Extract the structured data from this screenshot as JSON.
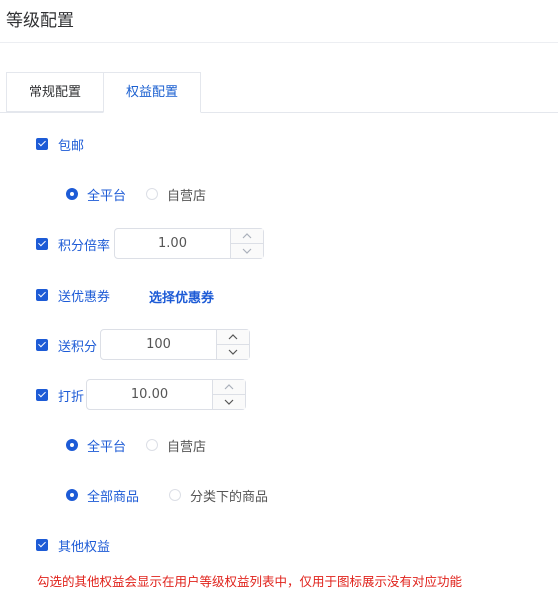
{
  "page": {
    "title": "等级配置"
  },
  "tabs": [
    {
      "label": "常规配置"
    },
    {
      "label": "权益配置"
    }
  ],
  "free_shipping": {
    "label": "包邮",
    "checked": true,
    "options": [
      {
        "label": "全平台",
        "selected": true
      },
      {
        "label": "自营店",
        "selected": false
      }
    ]
  },
  "points_multiplier": {
    "label": "积分倍率",
    "checked": true,
    "value": "1.00"
  },
  "coupon": {
    "label": "送优惠券",
    "checked": true,
    "link": "选择优惠券"
  },
  "give_points": {
    "label": "送积分",
    "checked": true,
    "value": "100"
  },
  "discount": {
    "label": "打折",
    "checked": true,
    "value": "10.00",
    "platform_options": [
      {
        "label": "全平台",
        "selected": true
      },
      {
        "label": "自营店",
        "selected": false
      }
    ],
    "goods_options": [
      {
        "label": "全部商品",
        "selected": true
      },
      {
        "label": "分类下的商品",
        "selected": false
      }
    ]
  },
  "other": {
    "label": "其他权益",
    "checked": true
  },
  "notice": "勾选的其他权益会显示在用户等级权益列表中，仅用于图标展示没有对应功能",
  "colors": {
    "accent": "#1d5bd6",
    "warning": "#e0231c",
    "border": "#dcdfe6"
  }
}
